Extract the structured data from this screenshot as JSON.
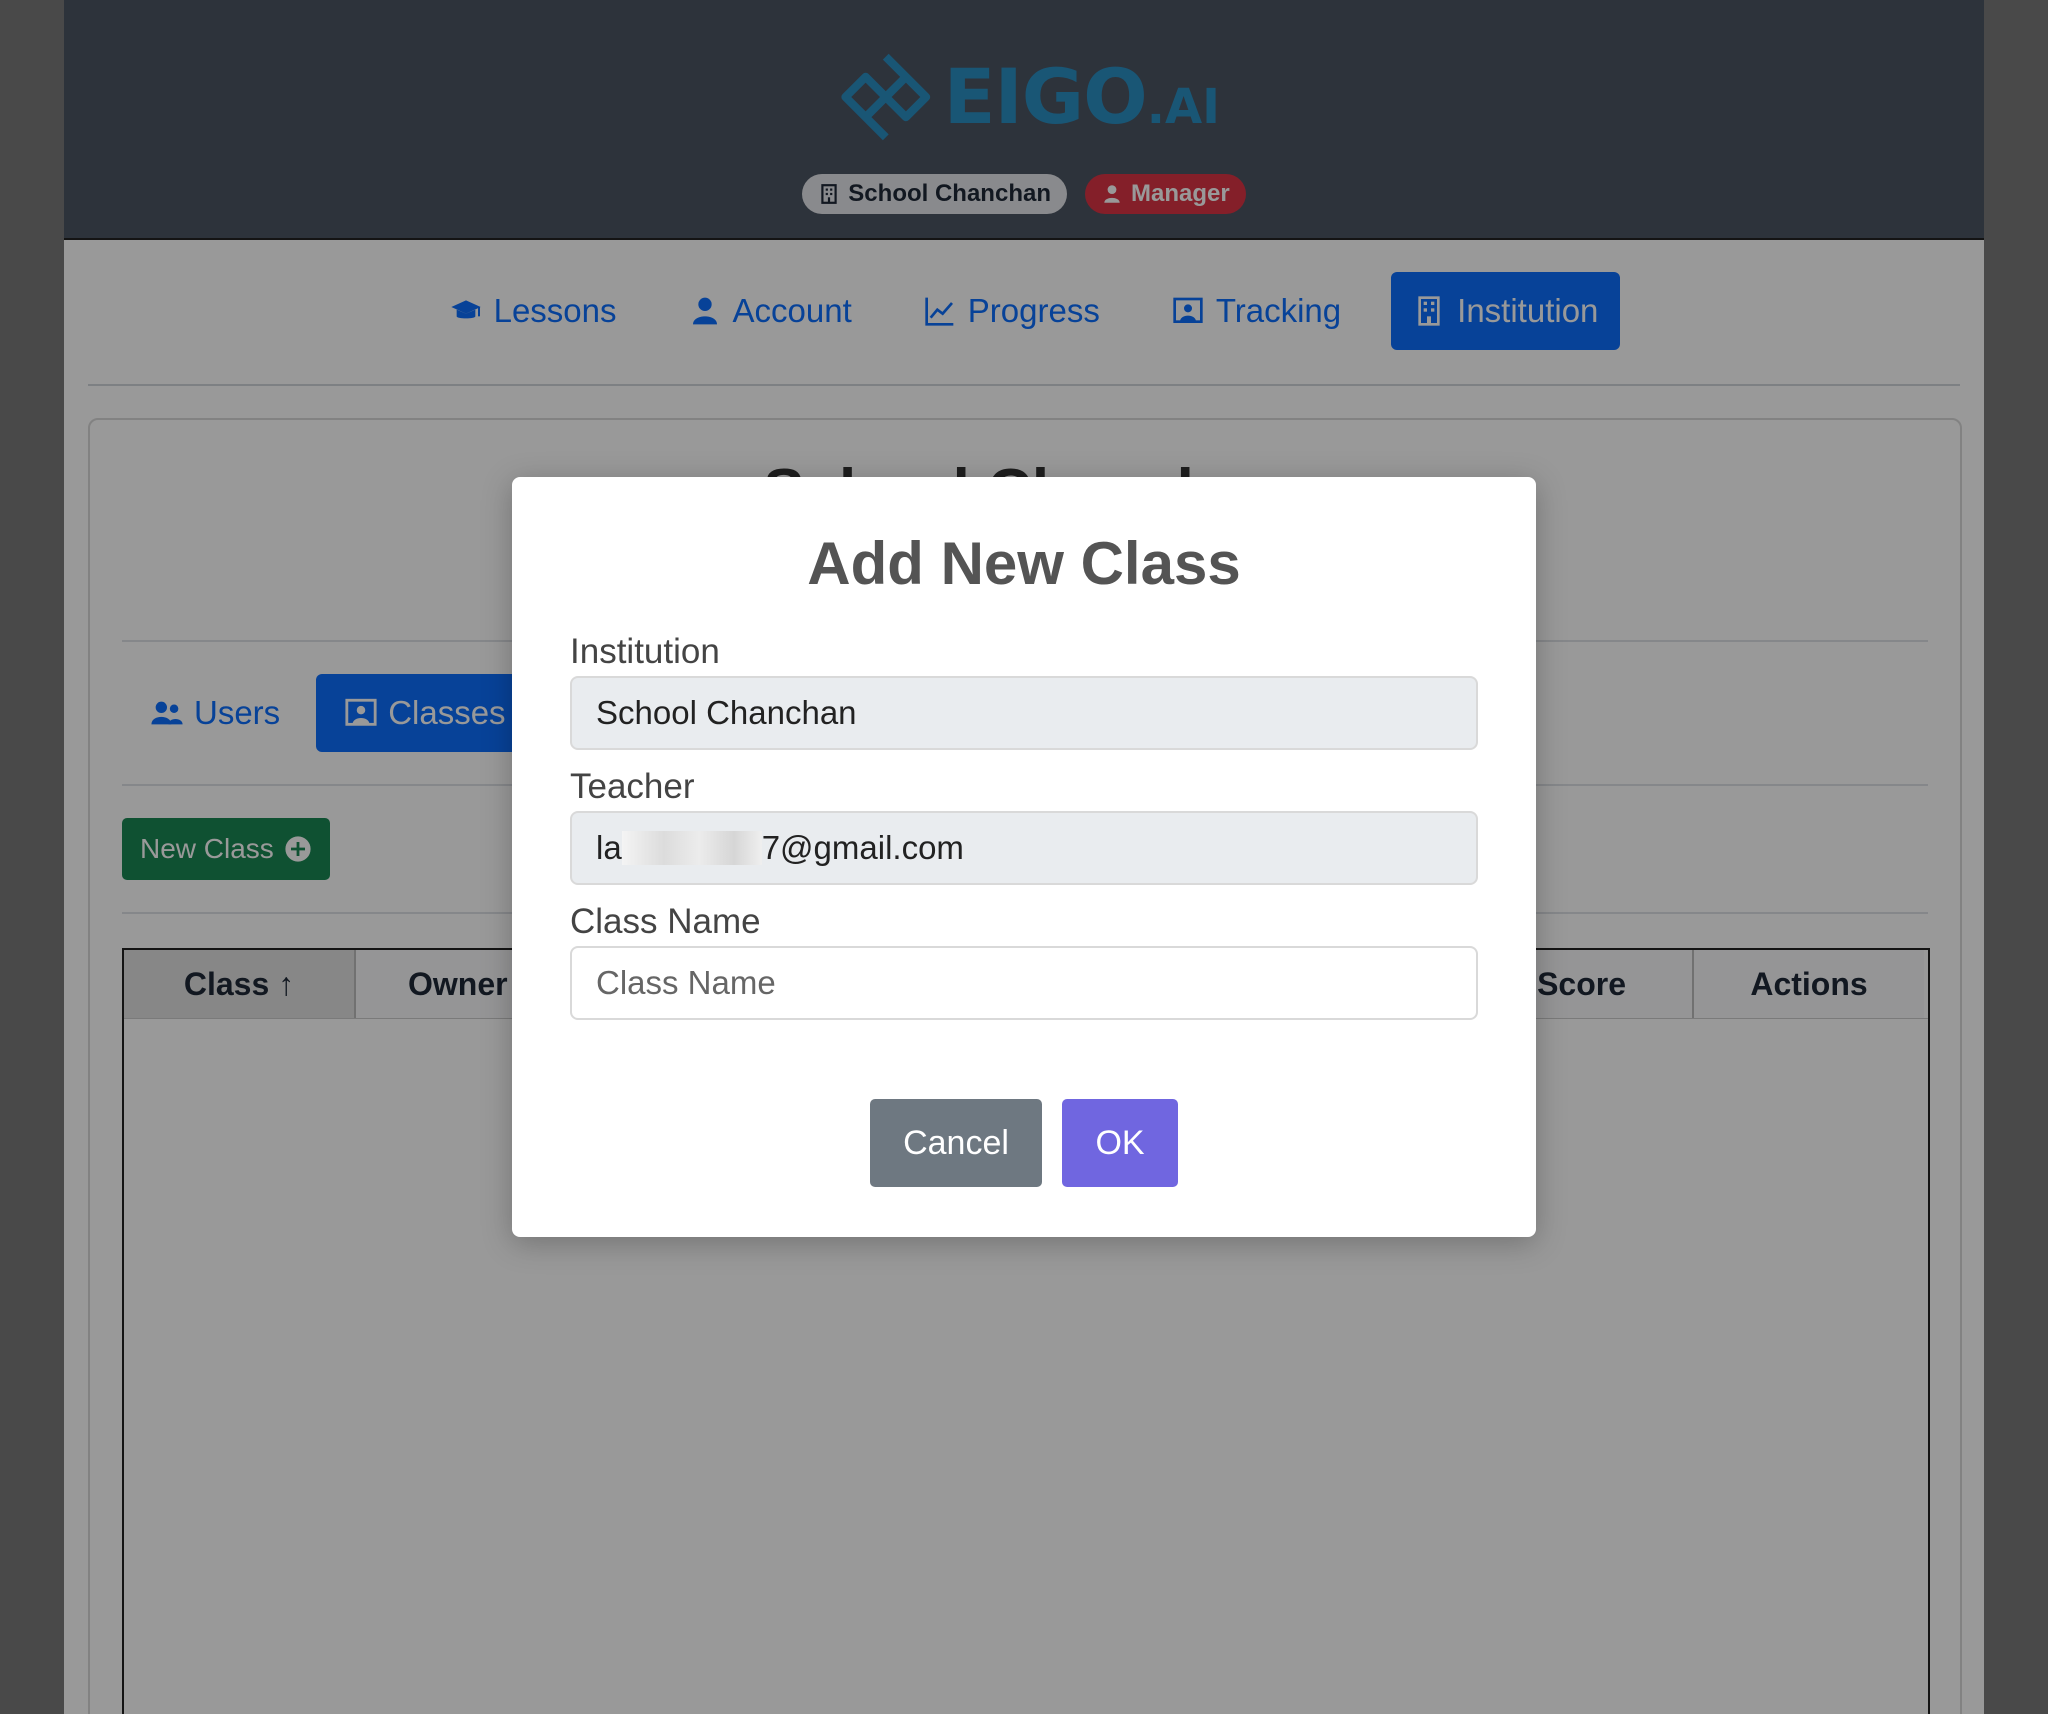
{
  "header": {
    "logo_text": "EIGO",
    "logo_suffix": ".AI",
    "school_badge": "School Chanchan",
    "role_badge": "Manager",
    "colors": {
      "background": "#4b5563",
      "logo": "#2b8fc4",
      "role_badge": "#dc3545"
    }
  },
  "nav": {
    "items": [
      {
        "label": "Lessons",
        "icon": "graduation-cap-icon"
      },
      {
        "label": "Account",
        "icon": "user-icon"
      },
      {
        "label": "Progress",
        "icon": "chart-line-icon"
      },
      {
        "label": "Tracking",
        "icon": "person-board-icon"
      },
      {
        "label": "Institution",
        "icon": "building-icon",
        "active": true
      }
    ],
    "active_color": "#0d6efd"
  },
  "institution_page": {
    "title": "School Chanchan",
    "tabs": [
      {
        "label": "Users",
        "icon": "users-icon"
      },
      {
        "label": "Classes",
        "icon": "person-board-icon",
        "active": true
      }
    ],
    "new_class_button": "New Class",
    "table": {
      "columns": [
        "Class ↑",
        "Owner",
        "Score",
        "Actions"
      ]
    }
  },
  "modal": {
    "title": "Add New Class",
    "institution_label": "Institution",
    "institution_value": "School Chanchan",
    "teacher_label": "Teacher",
    "teacher_value_prefix": "la",
    "teacher_value_suffix": "7@gmail.com",
    "class_name_label": "Class Name",
    "class_name_placeholder": "Class Name",
    "cancel_label": "Cancel",
    "ok_label": "OK",
    "colors": {
      "cancel": "#6e7881",
      "ok": "#7066e0"
    }
  }
}
